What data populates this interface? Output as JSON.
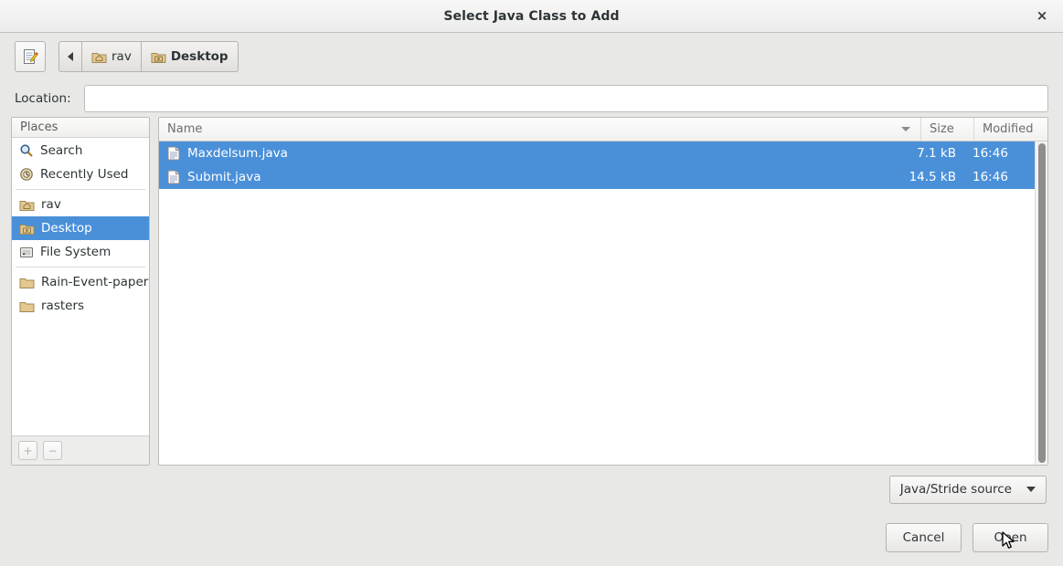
{
  "window": {
    "title": "Select Java Class to Add",
    "close_label": "×",
    "close_icon": "close-icon"
  },
  "toolbar": {
    "type_filename_icon": "document-pencil-icon",
    "back_icon": "triangle-left-icon",
    "breadcrumbs": [
      {
        "label": "rav",
        "icon": "home-folder-icon",
        "current": false
      },
      {
        "label": "Desktop",
        "icon": "desktop-folder-icon",
        "current": true
      }
    ]
  },
  "location": {
    "label": "Location:",
    "value": "",
    "placeholder": ""
  },
  "sidebar": {
    "header": "Places",
    "items": [
      {
        "label": "Search",
        "icon": "search-icon"
      },
      {
        "label": "Recently Used",
        "icon": "recent-clock-icon"
      },
      {
        "label": "rav",
        "icon": "home-folder-icon"
      },
      {
        "label": "Desktop",
        "icon": "desktop-folder-icon"
      },
      {
        "label": "File System",
        "icon": "drive-icon"
      },
      {
        "label": "Rain-Event-paper",
        "icon": "folder-icon"
      },
      {
        "label": "rasters",
        "icon": "folder-icon"
      }
    ],
    "selected_index": 3,
    "add_button": "+",
    "remove_button": "−"
  },
  "filelist": {
    "columns": {
      "name": "Name",
      "size": "Size",
      "modified": "Modified"
    },
    "sort_icon": "sort-descending-icon",
    "rows": [
      {
        "name": "Maxdelsum.java",
        "size": "7.1 kB",
        "modified": "16:46",
        "icon": "text-file-icon",
        "selected": true
      },
      {
        "name": "Submit.java",
        "size": "14.5 kB",
        "modified": "16:46",
        "icon": "text-file-icon",
        "selected": true
      }
    ]
  },
  "filter": {
    "selected": "Java/Stride source",
    "dropdown_icon": "chevron-down-icon"
  },
  "buttons": {
    "cancel": "Cancel",
    "open": "Open"
  },
  "colors": {
    "selection_blue": "#4a90d9",
    "dialog_bg": "#e8e8e7",
    "text": "#2e3436"
  }
}
